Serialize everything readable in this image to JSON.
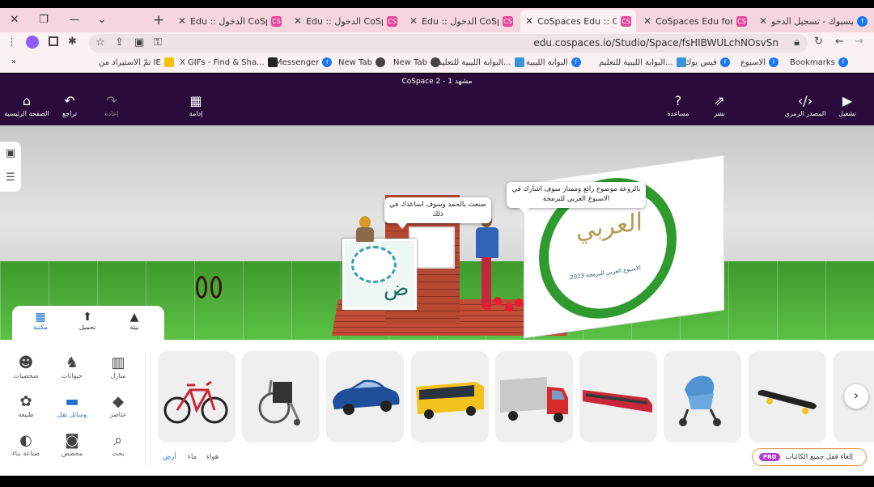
{
  "window": {
    "close_glyph": "✕",
    "restore_glyph": "❐",
    "minimize_glyph": "—",
    "dropdown_glyph": "⌄"
  },
  "tabs": [
    {
      "title": "Edu :: الدخول CoSpaces",
      "favicon": "cospaces-icon",
      "active": false
    },
    {
      "title": "Edu :: الدخول CoSpaces",
      "favicon": "cospaces-icon",
      "active": false
    },
    {
      "title": "Edu :: الدخول CoSpaces",
      "favicon": "cospaces-icon",
      "active": false
    },
    {
      "title": "CoSpaces Edu :: CoSp",
      "favicon": "cospaces-icon",
      "active": true
    },
    {
      "title": "CoSpaces Edu for kids",
      "favicon": "cospaces-icon",
      "active": false
    },
    {
      "title": "فيسبوك - تسجيل الدخو",
      "favicon": "facebook-icon",
      "active": false
    }
  ],
  "new_tab_glyph": "+",
  "address_bar": {
    "url": "edu.cospaces.io/Studio/Space/fsHIBWULchNOsvSn"
  },
  "bookmarks": [
    {
      "label": "Bookmarks",
      "icon": "facebook-icon"
    },
    {
      "label": "الاسبوع",
      "icon": "facebook-icon"
    },
    {
      "label": "فيس بوك",
      "icon": "facebook-icon"
    },
    {
      "label": "البوابة الليبية للتعليم...",
      "icon": "libya-icon"
    },
    {
      "label": "البوابة الليبية",
      "icon": "facebook-icon"
    },
    {
      "label": "البوابة الليبية للتعليم...",
      "icon": "libya-icon"
    },
    {
      "label": "New Tab",
      "icon": "globe-icon"
    },
    {
      "label": "New Tab",
      "icon": "globe-icon"
    },
    {
      "label": "Messenger",
      "icon": "facebook-icon"
    },
    {
      "label": "X GIFs - Find & Sha...",
      "icon": "messenger-icon"
    },
    {
      "label": "تمّ الاستيراد من IE",
      "icon": "folder-icon"
    }
  ],
  "bookmarks_overflow": "»",
  "cospaces_toolbar": {
    "scene_title": "CoSpace 2 - مشهد 1",
    "home_label": "الصفحة الرئيسية",
    "undo_label": "تراجع",
    "redo_label": "إعادة",
    "grid_label": "إدامة",
    "help_label": "مساعدة",
    "share_label": "نشر",
    "code_label": "المصدر الرمزي",
    "play_label": "تشغيل"
  },
  "scene": {
    "bubble_left": "صنعت يالحمد وسوف اساعدك في ذلك",
    "bubble_right": "بالروعة  موضوع رائع وممتاز سوف اشارك في الاسبوع العربي للبرمجة",
    "logo_text": "العربي",
    "logo_sub": "الاسبوع العربي للبرمجة 2023"
  },
  "library_tabs": [
    {
      "label": "بيئة",
      "icon": "image-icon",
      "active": false
    },
    {
      "label": "تحميل",
      "icon": "upload-icon",
      "active": false
    },
    {
      "label": "مكتبة",
      "icon": "grid-icon",
      "active": true
    }
  ],
  "categories": [
    {
      "label": "منازل",
      "icon": "building-icon",
      "active": false
    },
    {
      "label": "حيوانات",
      "icon": "dog-icon",
      "active": false
    },
    {
      "label": "شخصيات",
      "icon": "person-icon",
      "active": false
    },
    {
      "label": "عناصر",
      "icon": "diamond-icon",
      "active": false
    },
    {
      "label": "وسائل نقل",
      "icon": "car-icon",
      "active": true
    },
    {
      "label": "طبيعة",
      "icon": "flower-icon",
      "active": false
    },
    {
      "label": "بحث",
      "icon": "search-icon",
      "active": false
    },
    {
      "label": "مخصص",
      "icon": "camera-icon",
      "active": false
    },
    {
      "label": "صناعة بناء",
      "icon": "shapes-icon",
      "active": false
    }
  ],
  "items": [
    {
      "name": "bicycle"
    },
    {
      "name": "wheelchair"
    },
    {
      "name": "car"
    },
    {
      "name": "bus"
    },
    {
      "name": "truck"
    },
    {
      "name": "train"
    },
    {
      "name": "stroller"
    },
    {
      "name": "skateboard"
    }
  ],
  "subcategories": [
    {
      "label": "أرض",
      "active": true
    },
    {
      "label": "ماء",
      "active": false
    },
    {
      "label": "هواء",
      "active": false
    }
  ],
  "pro_pill": {
    "badge": "PRO",
    "label": "إلغاء قفل جميع الكائنات"
  },
  "next_glyph": "›"
}
